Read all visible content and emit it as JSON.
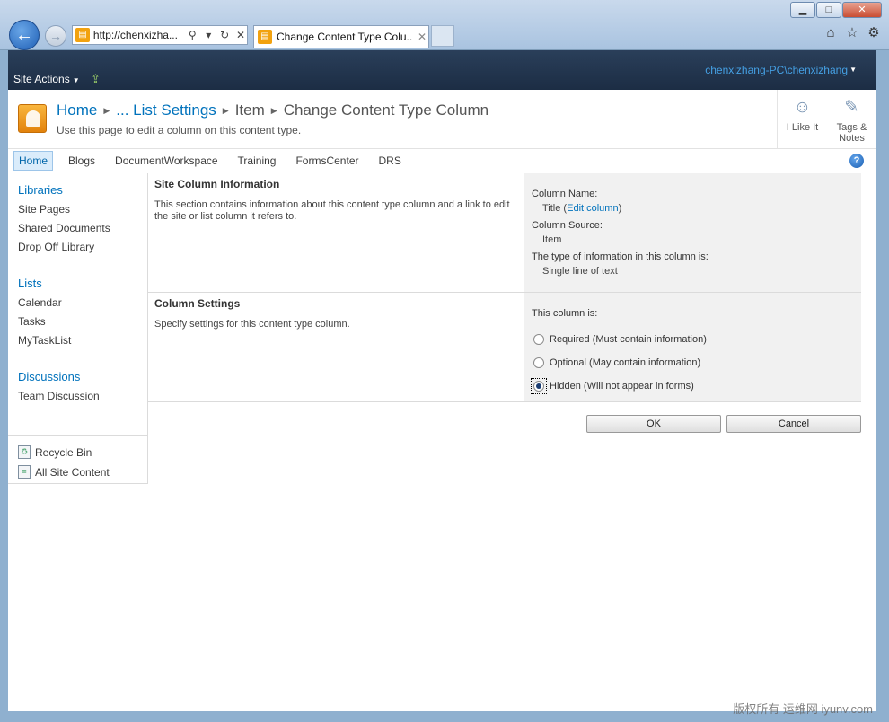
{
  "browser": {
    "address_url": "http://chenxizha...",
    "tab_title": "Change Content Type Colu...",
    "window_buttons": [
      "minimize-icon",
      "maximize-icon",
      "close-icon"
    ],
    "toolbar_icons": [
      "home-icon",
      "favorites-icon",
      "settings-icon"
    ]
  },
  "ribbon": {
    "site_actions": "Site Actions",
    "user": "chenxizhang-PC\\chenxizhang"
  },
  "title": {
    "breadcrumb": [
      "Home",
      "... List Settings",
      "Item",
      "Change Content Type Column"
    ],
    "description": "Use this page to edit a column on this content type."
  },
  "social": {
    "like": "I Like It",
    "tags": "Tags &",
    "tags2": "Notes"
  },
  "topnav": [
    "Home",
    "Blogs",
    "DocumentWorkspace",
    "Training",
    "FormsCenter",
    "DRS"
  ],
  "quicklaunch": {
    "libraries": "Libraries",
    "library_items": [
      "Site Pages",
      "Shared Documents",
      "Drop Off Library"
    ],
    "lists": "Lists",
    "list_items": [
      "Calendar",
      "Tasks",
      "MyTaskList"
    ],
    "discussions": "Discussions",
    "discussion_items": [
      "Team Discussion"
    ],
    "recycle_bin": "Recycle Bin",
    "all_site_content": "All Site Content"
  },
  "site_column": {
    "title": "Site Column Information",
    "description": "This section contains information about this content type column and a link to edit the site or list column it refers to.",
    "column_name_label": "Column Name:",
    "column_name_value": "Title",
    "edit_link": "Edit column",
    "column_source_label": "Column Source:",
    "column_source_value": "Item",
    "type_label": "The type of information in this column is:",
    "type_value": "Single line of text"
  },
  "column_settings": {
    "title": "Column Settings",
    "description": "Specify settings for this content type column.",
    "prompt": "This column is:",
    "options": [
      "Required (Must contain information)",
      "Optional (May contain information)",
      "Hidden (Will not appear in forms)"
    ],
    "selected": "Hidden (Will not appear in forms)"
  },
  "buttons": {
    "ok": "OK",
    "cancel": "Cancel"
  },
  "watermark": "版权所有 运维网 iyunv.com"
}
